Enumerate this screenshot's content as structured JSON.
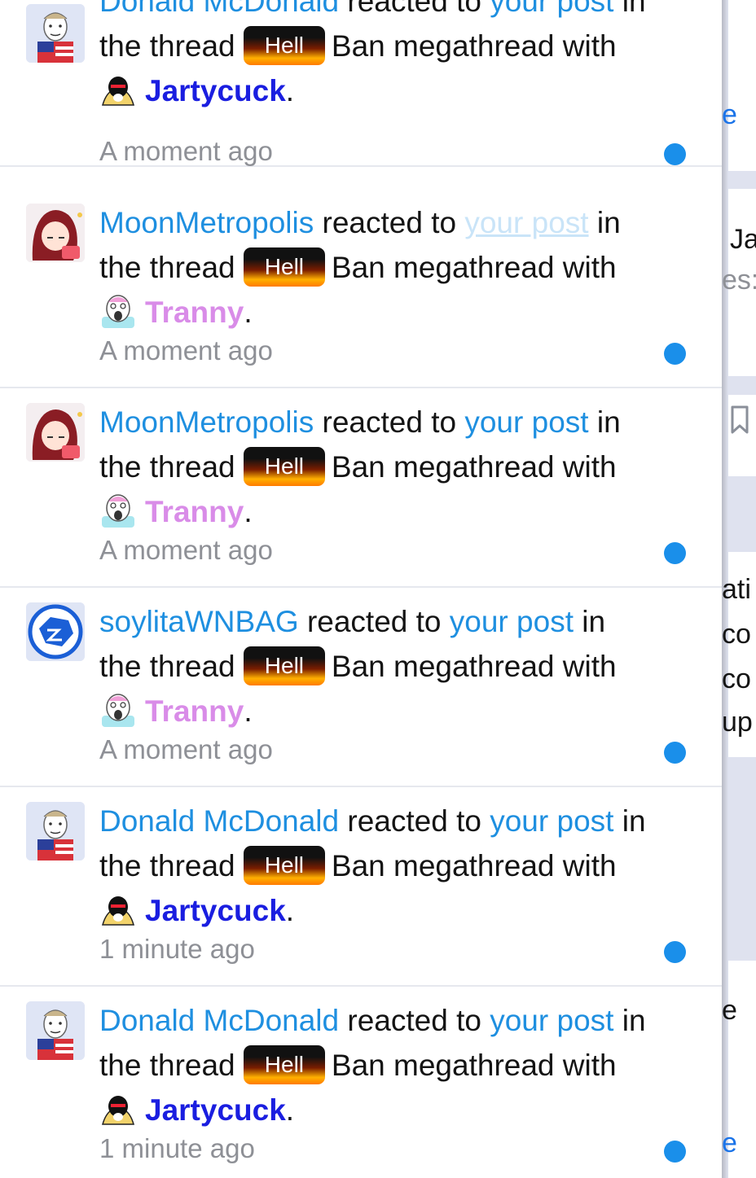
{
  "colors": {
    "link": "#1e8fe0",
    "unread_dot": "#1a8fea",
    "reaction_jartycuck": "#1a1ee0",
    "reaction_tranny": "#d98ce8",
    "time_text": "#8e9096"
  },
  "notifications": [
    {
      "username": "Donald McDonald",
      "reacted_text": "reacted to",
      "post_link": "your post",
      "in_text": "in",
      "thread_text": "the thread",
      "thread_prefix": "Hell",
      "thread_title": "Ban megathread",
      "with_text": "with",
      "reaction": "Jartycuck",
      "period": ".",
      "time": "A moment ago",
      "avatar": "donald-avatar"
    },
    {
      "username": "MoonMetropolis",
      "reacted_text": "reacted to",
      "post_link": "your post",
      "in_text": "in",
      "thread_text": "the thread",
      "thread_prefix": "Hell",
      "thread_title": "Ban megathread",
      "with_text": "with",
      "reaction": "Tranny",
      "period": ".",
      "time": "A moment ago",
      "avatar": "moon-avatar"
    },
    {
      "username": "MoonMetropolis",
      "reacted_text": "reacted to",
      "post_link": "your post",
      "in_text": "in",
      "thread_text": "the thread",
      "thread_prefix": "Hell",
      "thread_title": "Ban megathread",
      "with_text": "with",
      "reaction": "Tranny",
      "period": ".",
      "time": "A moment ago",
      "avatar": "moon-avatar"
    },
    {
      "username": "soylitaWNBAG",
      "reacted_text": "reacted to",
      "post_link": "your post",
      "in_text": "in",
      "thread_text": "the thread",
      "thread_prefix": "Hell",
      "thread_title": "Ban megathread",
      "with_text": "with",
      "reaction": "Tranny",
      "period": ".",
      "time": "A moment ago",
      "avatar": "soylita-avatar"
    },
    {
      "username": "Donald McDonald",
      "reacted_text": "reacted to",
      "post_link": "your post",
      "in_text": "in",
      "thread_text": "the thread",
      "thread_prefix": "Hell",
      "thread_title": "Ban megathread",
      "with_text": "with",
      "reaction": "Jartycuck",
      "period": ".",
      "time": "1 minute ago",
      "avatar": "donald-avatar"
    },
    {
      "username": "Donald McDonald",
      "reacted_text": "reacted to",
      "post_link": "your post",
      "in_text": "in",
      "thread_text": "the thread",
      "thread_prefix": "Hell",
      "thread_title": "Ban megathread",
      "with_text": "with",
      "reaction": "Jartycuck",
      "period": ".",
      "time": "1 minute ago",
      "avatar": "donald-avatar"
    }
  ],
  "background_fragments": [
    "e",
    "Ja",
    "es:",
    "ati",
    "co",
    "co",
    "up",
    "e",
    "e"
  ]
}
